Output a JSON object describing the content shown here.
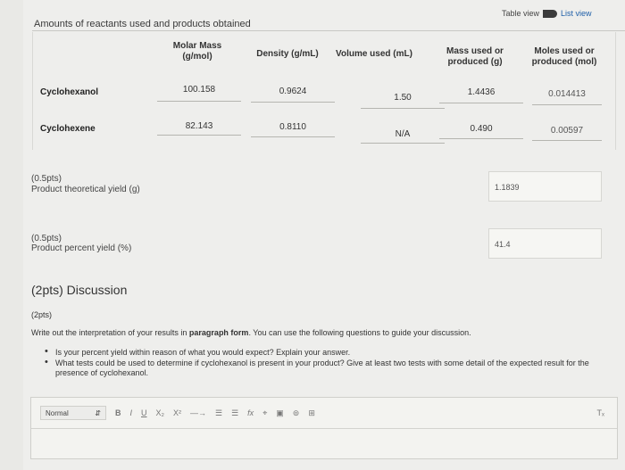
{
  "header": {
    "title": "Amounts of reactants used and products obtained",
    "table_view_label": "Table view",
    "list_view_label": "List view"
  },
  "table": {
    "columns": [
      "",
      "Molar Mass (g/mol)",
      "Density (g/mL)",
      "Volume used (mL)",
      "Mass used or produced (g)",
      "Moles used or produced (mol)"
    ],
    "rows": [
      {
        "label": "Cyclohexanol",
        "molar_mass": "100.158",
        "density": "0.9624",
        "volume": "1.50",
        "mass": "1.4436",
        "moles": "0.014413"
      },
      {
        "label": "Cyclohexene",
        "molar_mass": "82.143",
        "density": "0.8110",
        "volume": "N/A",
        "mass": "0.490",
        "moles": "0.00597"
      }
    ]
  },
  "theoretical_yield": {
    "points": "(0.5pts)",
    "label": "Product theoretical yield (g)",
    "value": "1.1839"
  },
  "percent_yield": {
    "points": "(0.5pts)",
    "label": "Product percent yield (%)",
    "value": "41.4"
  },
  "discussion": {
    "title": "(2pts) Discussion",
    "points": "(2pts)",
    "instruction_pre": "Write out the interpretation of your results in ",
    "instruction_bold": "paragraph form",
    "instruction_post": ". You can use the following questions to guide your discussion.",
    "bullets": [
      "Is your percent yield within reason of what you would expect? Explain your answer.",
      "What tests could be used to determine if cyclohexanol is present in your product? Give at least two tests with some detail of the expected result for the presence of cyclohexanol."
    ]
  },
  "editor": {
    "style_value": "Normal",
    "toolbar": {
      "bold": "B",
      "italic": "I",
      "underline": "U",
      "subscript": "X₂",
      "superscript": "X²",
      "arrow": "—→",
      "ordered_list": "☰",
      "unordered_list": "☰",
      "formula": "fx",
      "link": "⌖",
      "image": "▣",
      "embed": "⊚",
      "table": "⊞",
      "clear_format": "Tₓ"
    }
  }
}
